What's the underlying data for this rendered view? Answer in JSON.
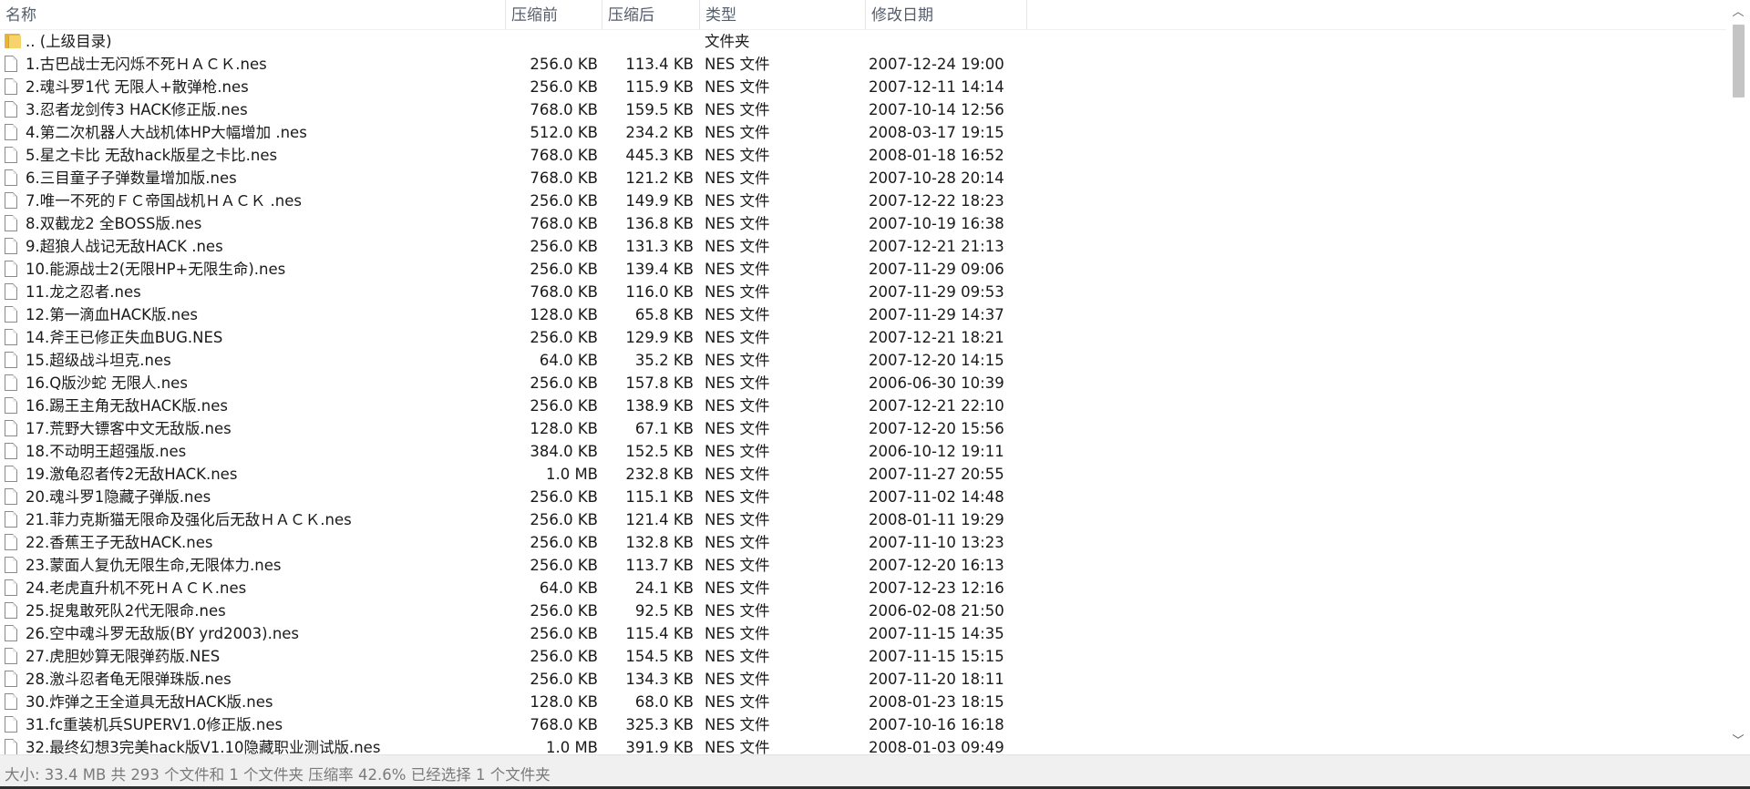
{
  "header": {
    "name": "名称",
    "size_before": "压缩前",
    "size_after": "压缩后",
    "type": "类型",
    "modified": "修改日期"
  },
  "rows": [
    {
      "icon": "folder-icon",
      "name": ".. (上级目录)",
      "before": "",
      "after": "",
      "type": "文件夹",
      "date": ""
    },
    {
      "icon": "file-icon",
      "name": "1.古巴战士无闪烁不死ＨＡＣＫ.nes",
      "before": "256.0 KB",
      "after": "113.4 KB",
      "type": "NES 文件",
      "date": "2007-12-24 19:00"
    },
    {
      "icon": "file-icon",
      "name": "2.魂斗罗1代 无限人+散弹枪.nes",
      "before": "256.0 KB",
      "after": "115.9 KB",
      "type": "NES 文件",
      "date": "2007-12-11 14:14"
    },
    {
      "icon": "file-icon",
      "name": "3.忍者龙剑传3 HACK修正版.nes",
      "before": "768.0 KB",
      "after": "159.5 KB",
      "type": "NES 文件",
      "date": "2007-10-14 12:56"
    },
    {
      "icon": "file-icon",
      "name": "4.第二次机器人大战机体HP大幅增加 .nes",
      "before": "512.0 KB",
      "after": "234.2 KB",
      "type": "NES 文件",
      "date": "2008-03-17 19:15"
    },
    {
      "icon": "file-icon",
      "name": "5.星之卡比 无敌hack版星之卡比.nes",
      "before": "768.0 KB",
      "after": "445.3 KB",
      "type": "NES 文件",
      "date": "2008-01-18 16:52"
    },
    {
      "icon": "file-icon",
      "name": "6.三目童子子弹数量增加版.nes",
      "before": "768.0 KB",
      "after": "121.2 KB",
      "type": "NES 文件",
      "date": "2007-10-28 20:14"
    },
    {
      "icon": "file-icon",
      "name": "7.唯一不死的ＦＣ帝国战机ＨＡＣＫ .nes",
      "before": "256.0 KB",
      "after": "149.9 KB",
      "type": "NES 文件",
      "date": "2007-12-22 18:23"
    },
    {
      "icon": "file-icon",
      "name": "8.双截龙2 全BOSS版.nes",
      "before": "768.0 KB",
      "after": "136.8 KB",
      "type": "NES 文件",
      "date": "2007-10-19 16:38"
    },
    {
      "icon": "file-icon",
      "name": "9.超狼人战记无敌HACK .nes",
      "before": "256.0 KB",
      "after": "131.3 KB",
      "type": "NES 文件",
      "date": "2007-12-21 21:13"
    },
    {
      "icon": "file-icon",
      "name": "10.能源战士2(无限HP+无限生命).nes",
      "before": "256.0 KB",
      "after": "139.4 KB",
      "type": "NES 文件",
      "date": "2007-11-29 09:06"
    },
    {
      "icon": "file-icon",
      "name": "11.龙之忍者.nes",
      "before": "768.0 KB",
      "after": "116.0 KB",
      "type": "NES 文件",
      "date": "2007-11-29 09:53"
    },
    {
      "icon": "file-icon",
      "name": "12.第一滴血HACK版.nes",
      "before": "128.0 KB",
      "after": "65.8 KB",
      "type": "NES 文件",
      "date": "2007-11-29 14:37"
    },
    {
      "icon": "file-icon",
      "name": "14.斧王已修正失血BUG.NES",
      "before": "256.0 KB",
      "after": "129.9 KB",
      "type": "NES 文件",
      "date": "2007-12-21 18:21"
    },
    {
      "icon": "file-icon",
      "name": "15.超级战斗坦克.nes",
      "before": "64.0 KB",
      "after": "35.2 KB",
      "type": "NES 文件",
      "date": "2007-12-20 14:15"
    },
    {
      "icon": "file-icon",
      "name": "16.Q版沙蛇 无限人.nes",
      "before": "256.0 KB",
      "after": "157.8 KB",
      "type": "NES 文件",
      "date": "2006-06-30 10:39"
    },
    {
      "icon": "file-icon",
      "name": "16.踢王主角无敌HACK版.nes",
      "before": "256.0 KB",
      "after": "138.9 KB",
      "type": "NES 文件",
      "date": "2007-12-21 22:10"
    },
    {
      "icon": "file-icon",
      "name": "17.荒野大镖客中文无敌版.nes",
      "before": "128.0 KB",
      "after": "67.1 KB",
      "type": "NES 文件",
      "date": "2007-12-20 15:56"
    },
    {
      "icon": "file-icon",
      "name": "18.不动明王超强版.nes",
      "before": "384.0 KB",
      "after": "152.5 KB",
      "type": "NES 文件",
      "date": "2006-10-12 19:11"
    },
    {
      "icon": "file-icon",
      "name": "19.激龟忍者传2无敌HACK.nes",
      "before": "1.0 MB",
      "after": "232.8 KB",
      "type": "NES 文件",
      "date": "2007-11-27 20:55"
    },
    {
      "icon": "file-icon",
      "name": "20.魂斗罗1隐藏子弹版.nes",
      "before": "256.0 KB",
      "after": "115.1 KB",
      "type": "NES 文件",
      "date": "2007-11-02 14:48"
    },
    {
      "icon": "file-icon",
      "name": "21.菲力克斯猫无限命及强化后无敌ＨＡＣＫ.nes",
      "before": "256.0 KB",
      "after": "121.4 KB",
      "type": "NES 文件",
      "date": "2008-01-11 19:29"
    },
    {
      "icon": "file-icon",
      "name": "22.香蕉王子无敌HACK.nes",
      "before": "256.0 KB",
      "after": "132.8 KB",
      "type": "NES 文件",
      "date": "2007-11-10 13:23"
    },
    {
      "icon": "file-icon",
      "name": "23.蒙面人复仇无限生命,无限体力.nes",
      "before": "256.0 KB",
      "after": "113.7 KB",
      "type": "NES 文件",
      "date": "2007-12-20 16:13"
    },
    {
      "icon": "file-icon",
      "name": "24.老虎直升机不死ＨＡＣＫ.nes",
      "before": "64.0 KB",
      "after": "24.1 KB",
      "type": "NES 文件",
      "date": "2007-12-23 12:16"
    },
    {
      "icon": "file-icon",
      "name": "25.捉鬼敢死队2代无限命.nes",
      "before": "256.0 KB",
      "after": "92.5 KB",
      "type": "NES 文件",
      "date": "2006-02-08 21:50"
    },
    {
      "icon": "file-icon",
      "name": "26.空中魂斗罗无敌版(BY yrd2003).nes",
      "before": "256.0 KB",
      "after": "115.4 KB",
      "type": "NES 文件",
      "date": "2007-11-15 14:35"
    },
    {
      "icon": "file-icon",
      "name": "27.虎胆妙算无限弹药版.NES",
      "before": "256.0 KB",
      "after": "154.5 KB",
      "type": "NES 文件",
      "date": "2007-11-15 15:15"
    },
    {
      "icon": "file-icon",
      "name": "28.激斗忍者龟无限弹珠版.nes",
      "before": "256.0 KB",
      "after": "134.3 KB",
      "type": "NES 文件",
      "date": "2007-11-20 18:11"
    },
    {
      "icon": "file-icon",
      "name": "30.炸弹之王全道具无敌HACK版.nes",
      "before": "128.0 KB",
      "after": "68.0 KB",
      "type": "NES 文件",
      "date": "2008-01-23 18:15"
    },
    {
      "icon": "file-icon",
      "name": "31.fc重装机兵SUPERV1.0修正版.nes",
      "before": "768.0 KB",
      "after": "325.3 KB",
      "type": "NES 文件",
      "date": "2007-10-16 16:18"
    },
    {
      "icon": "file-icon",
      "name": "32.最终幻想3完美hack版V1.10隐藏职业测试版.nes",
      "before": "1.0 MB",
      "after": "391.9 KB",
      "type": "NES 文件",
      "date": "2008-01-03 09:49"
    }
  ],
  "scrollbar": {
    "up_arrow": "︿",
    "down_arrow": "﹀"
  },
  "status": {
    "text": "大小: 33.4 MB 共 293 个文件和 1 个文件夹 压缩率 42.6% 已经选择 1 个文件夹"
  }
}
